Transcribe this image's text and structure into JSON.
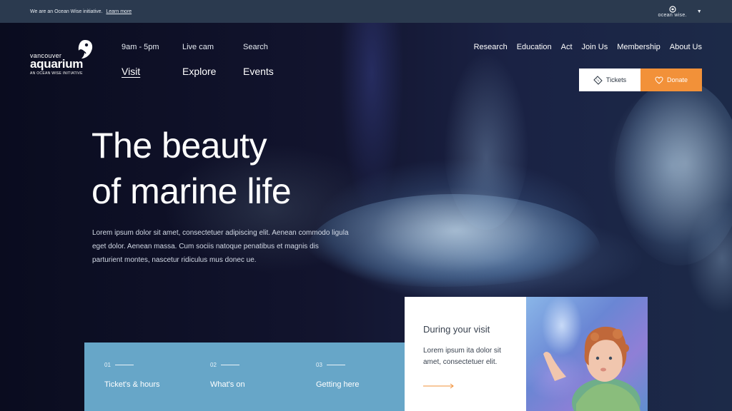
{
  "topbar": {
    "initiative_text": "We are an Ocean Wise initiative.",
    "learn_more": "Learn more",
    "brand": "ocean wise."
  },
  "logo": {
    "line1": "vancouver",
    "line2": "aquarium",
    "line3": "AN OCEAN WISE INITIATIVE"
  },
  "nav": [
    {
      "small": "9am - 5pm",
      "big": "Visit"
    },
    {
      "small": "Live cam",
      "big": "Explore"
    },
    {
      "small": "Search",
      "big": "Events"
    }
  ],
  "utility_nav": [
    "Research",
    "Education",
    "Act",
    "Join Us",
    "Membership",
    "About Us"
  ],
  "buttons": {
    "tickets": "Tickets",
    "donate": "Donate"
  },
  "hero": {
    "headline_line1": "The beauty",
    "headline_line2": "of marine life",
    "lead": "Lorem ipsum dolor sit amet, consectetuer adipiscing elit. Aenean commodo ligula eget dolor. Aenean massa. Cum sociis natoque penatibus et magnis dis parturient montes, nascetur ridiculus mus donec ue."
  },
  "quick_links": [
    {
      "num": "01",
      "title": "Ticket's & hours"
    },
    {
      "num": "02",
      "title": "What's on"
    },
    {
      "num": "03",
      "title": "Getting here"
    }
  ],
  "visit_card": {
    "title": "During your visit",
    "body": "Lorem ipsum ita dolor sit amet, consectetuer elit."
  },
  "colors": {
    "topbar": "#2b3a4f",
    "accent_orange": "#f29139",
    "panel_blue": "#67a6c8"
  }
}
